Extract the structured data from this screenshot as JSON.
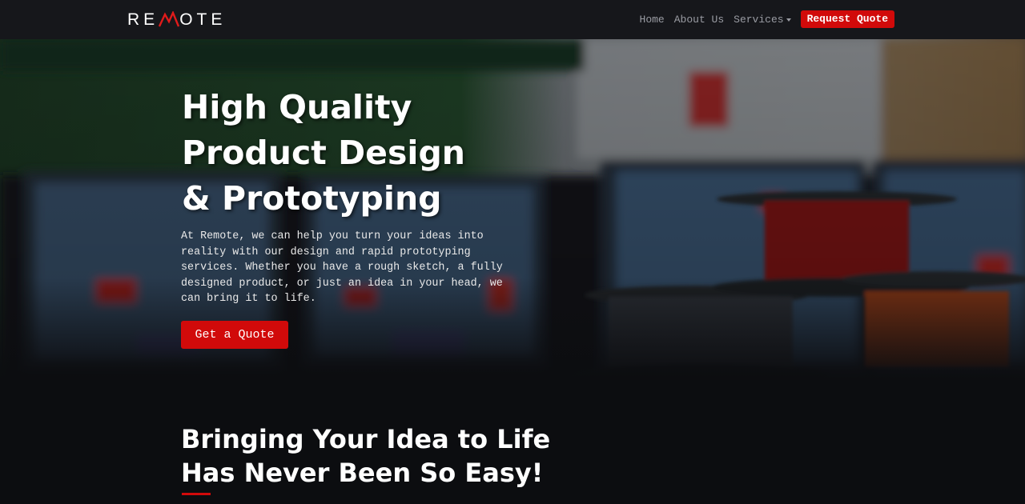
{
  "brand": {
    "logo_prefix": "RE",
    "logo_suffix": "OTE",
    "logo_accent_color": "#e01b1b"
  },
  "nav": {
    "links": [
      {
        "label": "Home"
      },
      {
        "label": "About Us"
      },
      {
        "label": "Services"
      }
    ],
    "cta_label": "Request Quote",
    "cta_color": "#d10a0a"
  },
  "hero": {
    "title_lines": [
      "High Quality",
      "Product Design",
      "& Prototyping"
    ],
    "paragraph": "At Remote, we can help you turn your ideas into reality with our design and rapid prototyping services. Whether you have a rough sketch, a fully designed product, or just an idea in your head, we can bring it to life.",
    "button_label": "Get a Quote"
  },
  "section": {
    "title_lines": [
      "Bringing Your Idea to Life",
      "Has Never Been So Easy!"
    ]
  },
  "icons": {
    "logo_m": "mountain-peak-icon",
    "services_caret": "chevron-down-icon"
  }
}
